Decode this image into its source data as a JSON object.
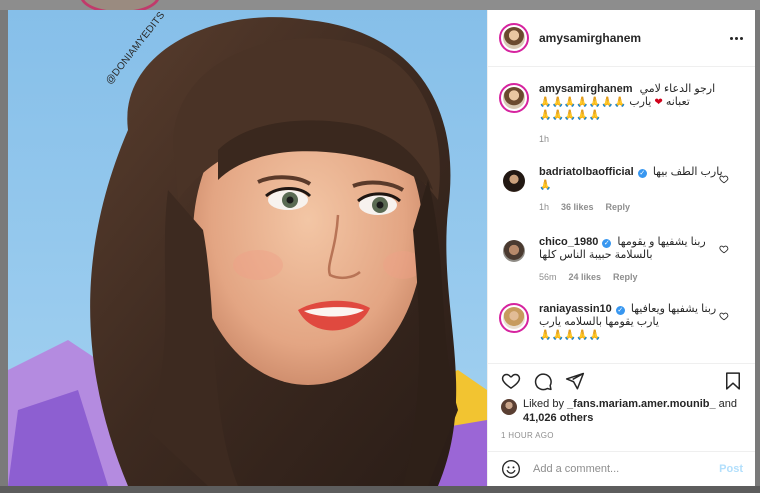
{
  "watermark": "@DONIAMYEDITS",
  "post": {
    "username": "amysamirghanem"
  },
  "caption": {
    "user": "amysamirghanem",
    "text_line1": "ارجو الدعاء لامي",
    "text_line2a": "تعبانه",
    "text_line2b": "يارب",
    "time": "1h",
    "emoji_row1": "🙏🙏🙏🙏🙏🙏🙏",
    "emoji_row2": "🙏🙏🙏🙏🙏"
  },
  "comments": [
    {
      "user": "badriatolbaofficial",
      "verified": "✓",
      "text": "يارب الطف بيها",
      "emoji": "🙏",
      "time": "1h",
      "likes": "36 likes",
      "reply": "Reply"
    },
    {
      "user": "chico_1980",
      "verified": "✓",
      "text": "ربنا يشفيها و يقومها بالسلامة حبيبة الناس كلها",
      "time": "56m",
      "likes": "24 likes",
      "reply": "Reply"
    },
    {
      "user": "raniayassin10",
      "verified": "✓",
      "text": "ربنا يشفيها ويعافيها يارب يقومها بالسلامه يارب",
      "emoji": "🙏🙏🙏🙏🙏"
    }
  ],
  "likes": {
    "prefix": "Liked by",
    "user": "_fans.mariam.amer.mounib_",
    "connector": "and",
    "count": "41,026 others"
  },
  "time_ago": "1 HOUR AGO",
  "add_comment": {
    "placeholder": "Add a comment...",
    "post_label": "Post"
  },
  "colors": {
    "link_blue": "#3897f0",
    "post_disabled": "#b2dffc",
    "story_ring": "#d6249f",
    "heart_red": "#d0021b"
  }
}
